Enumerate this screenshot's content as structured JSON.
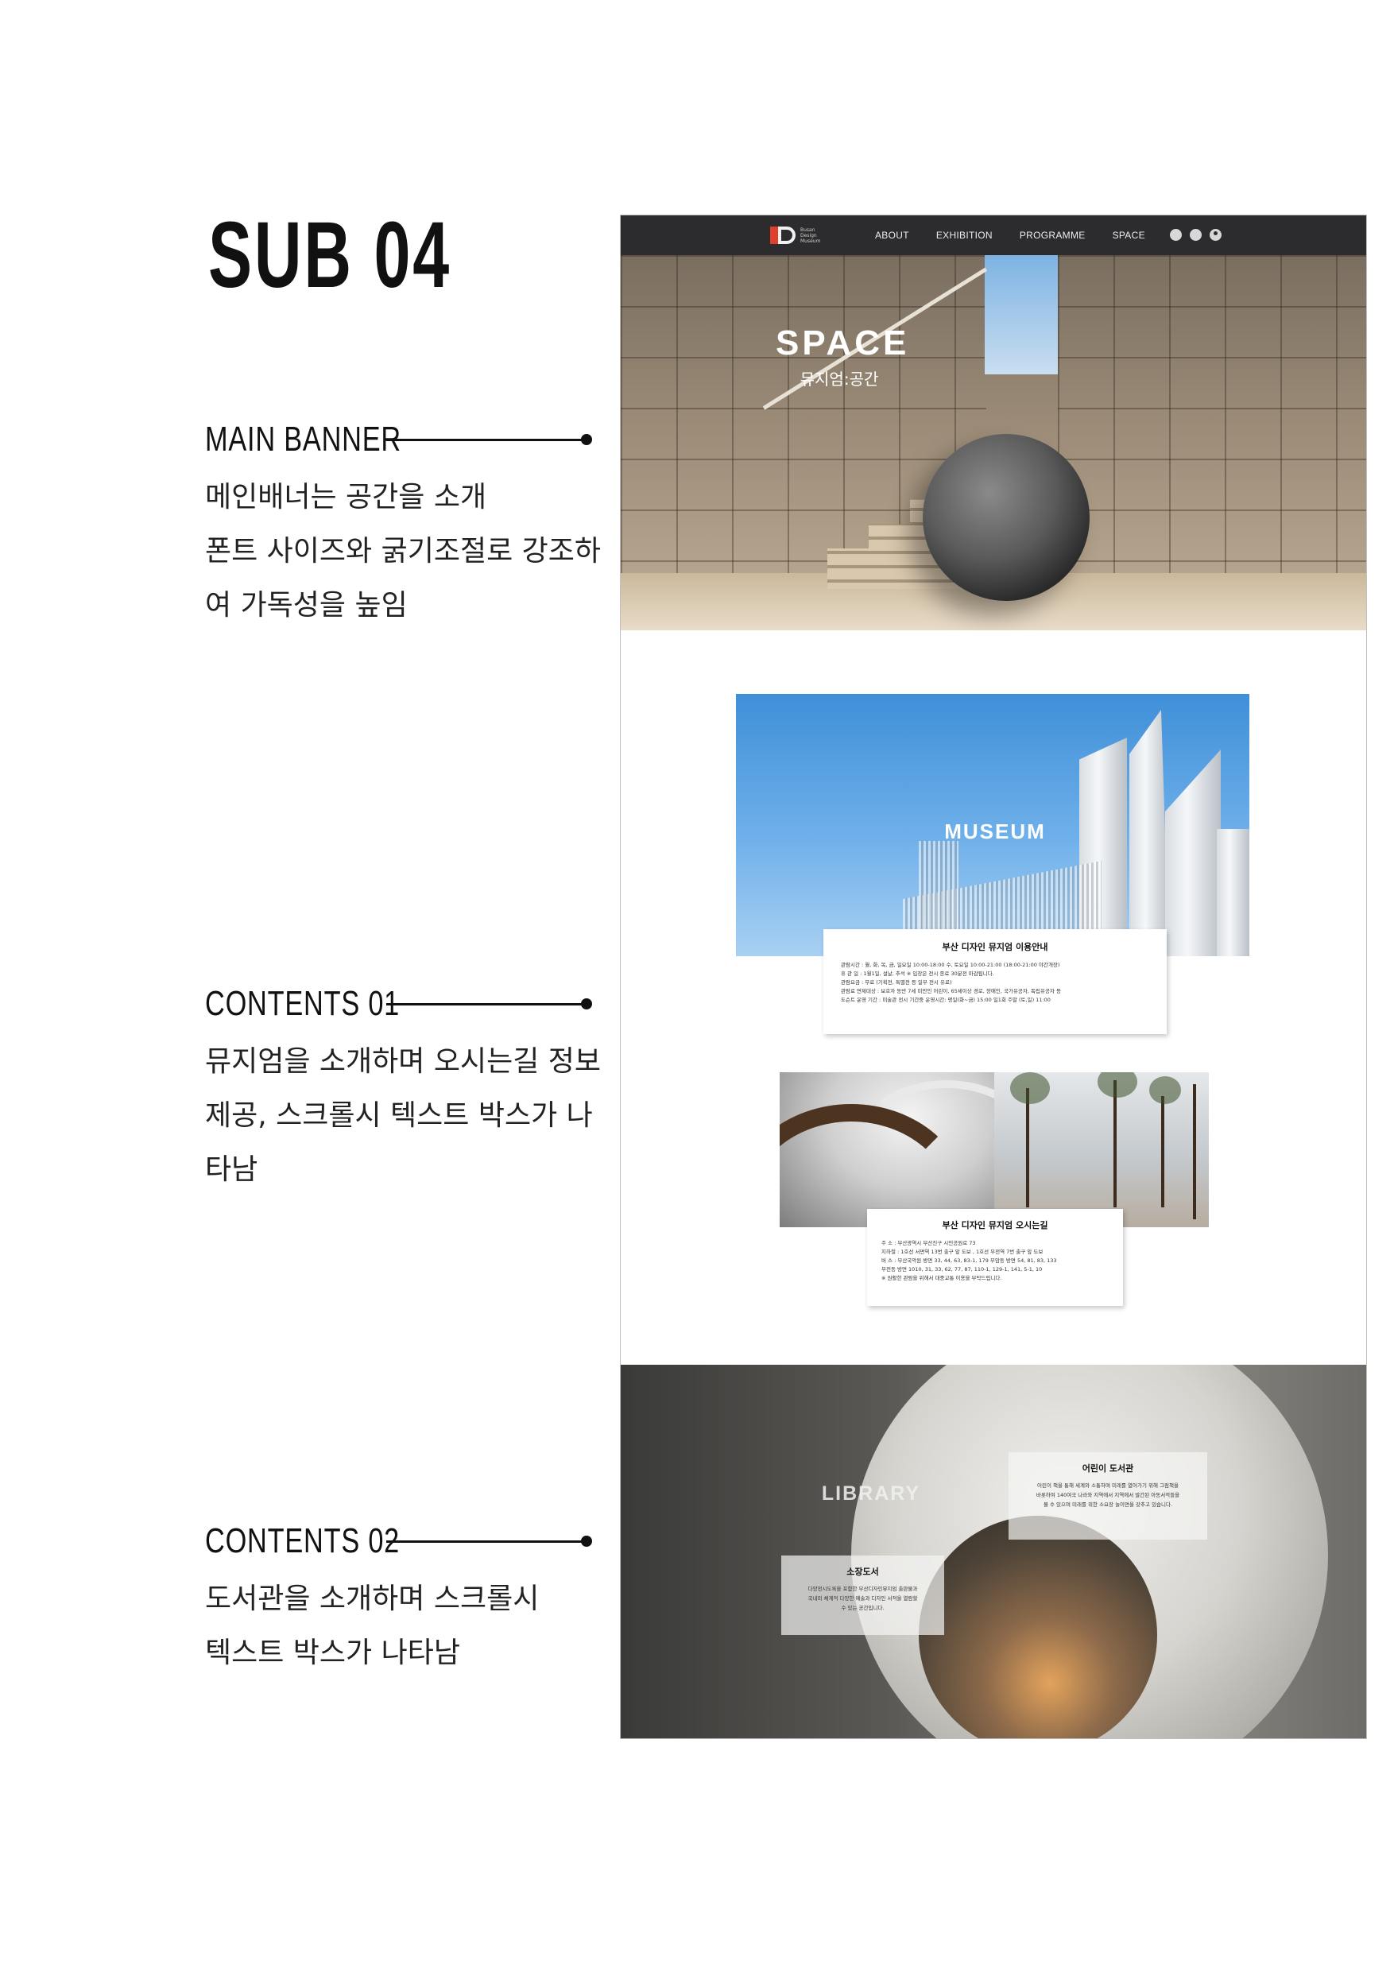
{
  "page": {
    "title": "SUB 04"
  },
  "annotations": [
    {
      "label": "MAIN BANNER",
      "lines": [
        "메인배너는 공간을 소개",
        "폰트 사이즈와 굵기조절로 강조하",
        "여 가독성을 높임"
      ]
    },
    {
      "label": "CONTENTS 01",
      "lines": [
        "뮤지엄을 소개하며 오시는길 정보",
        "제공, 스크롤시 텍스트 박스가 나",
        "타남"
      ]
    },
    {
      "label": "CONTENTS 02",
      "lines": [
        "도서관을 소개하며 스크롤시",
        "텍스트 박스가 나타남"
      ]
    }
  ],
  "mockup": {
    "nav": {
      "logo_text": [
        "Busan",
        "Design",
        "Museum"
      ],
      "items": [
        "ABOUT",
        "EXHIBITION",
        "PROGRAMME",
        "SPACE"
      ],
      "icons": [
        "globe-icon",
        "search-icon",
        "user-icon"
      ],
      "background": "#2c2c2e"
    },
    "hero": {
      "title": "SPACE",
      "subtitle": "뮤지엄:공간"
    },
    "museum": {
      "label": "MUSEUM",
      "info_title": "부산 디자인 뮤지엄 이용안내",
      "info_lines": [
        "관람시간 : 월, 화, 목, 금, 일요일 10:00-18:00      수, 토요일 10:00-21:00 (18:00-21:00 야간개장)",
        "휴 관 일 : 1월1일, 설날, 추석      ※ 입장은 전시 종료 30분전 마감됩니다.",
        "관람요금 : 무료 (기획전, 특별전 등 일부 전시 유료)",
        "관람료 면제대상 : 보호자 동반 7세 미만인 어린이, 65세이상 경로, 장애인, 국가유공자, 독립유공자 등",
        "도슨트 운영 기간 : 미술관 전시 기간중 운영시간: 평일(화~금) 15:00 일1회   주말 (토,일) 11:00"
      ]
    },
    "directions": {
      "title": "부산 디자인 뮤지엄 오시는길",
      "lines": [
        "주 소 : 부산광역시 부산진구 시민공원로 73",
        "지하철 : 1호선 서면역 13번 출구 앞 도보 , 1호선 부전역 7번 출구 앞 도보",
        "버 스 : 부산국악원 방면   33, 44, 63, 83-1, 179   부암동 방면   54, 81, 83, 133",
        "           부전동 방면   1010, 31, 33, 62, 77, 87, 110-1, 129-1, 141, 5-1, 10",
        "※ 원활한 관람을 위해서 대중교통 이용을 부탁드립니다."
      ]
    },
    "library": {
      "label": "LIBRARY",
      "kids": {
        "title": "어린이 도서관",
        "text": [
          "어린이 책을 통해 세계와 소통하며 미래를 열어가기 위해 그림책을",
          "바롯하여 140여국 나라와 지역에서 지역에서 발간된 아동서적들을",
          "볼 수 있으며 미래를 위한 소요장 놀이면을 갖추고 있습니다."
        ]
      },
      "archive": {
        "title": "소장도서",
        "text": [
          "다양전시도록을 포함한 부산디자인뮤지엄 출판물과",
          "국내외 체계적 다양한 예술과 디자인 서적을 열람할",
          "수 있는 공간입니다."
        ]
      }
    }
  }
}
